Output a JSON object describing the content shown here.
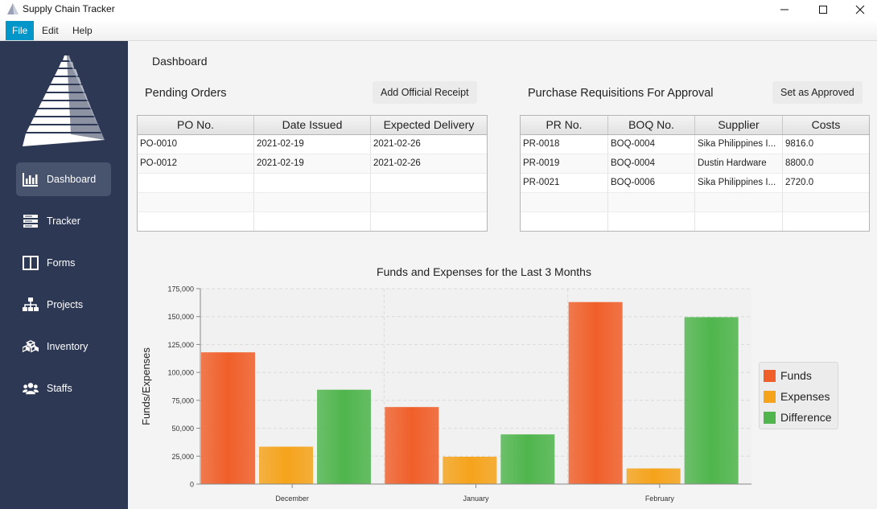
{
  "window": {
    "title": "Supply Chain Tracker"
  },
  "menu": [
    {
      "label": "File",
      "active": true
    },
    {
      "label": "Edit",
      "active": false
    },
    {
      "label": "Help",
      "active": false
    }
  ],
  "sidebar": {
    "items": [
      {
        "label": "Dashboard",
        "icon": "bar-chart-icon",
        "active": true
      },
      {
        "label": "Tracker",
        "icon": "server-stack-icon",
        "active": false
      },
      {
        "label": "Forms",
        "icon": "columns-icon",
        "active": false
      },
      {
        "label": "Projects",
        "icon": "sitemap-icon",
        "active": false
      },
      {
        "label": "Inventory",
        "icon": "cubes-icon",
        "active": false
      },
      {
        "label": "Staffs",
        "icon": "users-icon",
        "active": false
      }
    ]
  },
  "main": {
    "title": "Dashboard",
    "pending_orders": {
      "title": "Pending Orders",
      "button": "Add Official Receipt",
      "columns": [
        "PO No.",
        "Date Issued",
        "Expected Delivery"
      ],
      "rows": [
        [
          "PO-0010",
          "2021-02-19",
          "2021-02-26"
        ],
        [
          "PO-0012",
          "2021-02-19",
          "2021-02-26"
        ]
      ]
    },
    "requisitions": {
      "title": "Purchase Requisitions For Approval",
      "button": "Set as Approved",
      "columns": [
        "PR No.",
        "BOQ No.",
        "Supplier",
        "Costs"
      ],
      "rows": [
        [
          "PR-0018",
          "BOQ-0004",
          "Sika Philippines I...",
          "9816.0"
        ],
        [
          "PR-0019",
          "BOQ-0004",
          "Dustin Hardware",
          "8800.0"
        ],
        [
          "PR-0021",
          "BOQ-0006",
          "Sika Philippines I...",
          "2720.0"
        ]
      ]
    }
  },
  "chart_data": {
    "type": "bar",
    "title": "Funds and Expenses for the Last 3 Months",
    "xlabel": "",
    "ylabel": "Funds/Expenses",
    "categories": [
      "December",
      "January",
      "February"
    ],
    "series": [
      {
        "name": "Funds",
        "color": "#f05f2a",
        "values": [
          118000,
          69000,
          163000
        ]
      },
      {
        "name": "Expenses",
        "color": "#f5a31b",
        "values": [
          33500,
          24500,
          14000
        ]
      },
      {
        "name": "Difference",
        "color": "#4fb54c",
        "values": [
          84500,
          44500,
          149500
        ]
      }
    ],
    "ylim": [
      0,
      175000
    ],
    "yticks": [
      "0",
      "25,000",
      "50,000",
      "75,000",
      "100,000",
      "125,000",
      "150,000",
      "175,000"
    ],
    "grid": true,
    "legend": "right"
  }
}
